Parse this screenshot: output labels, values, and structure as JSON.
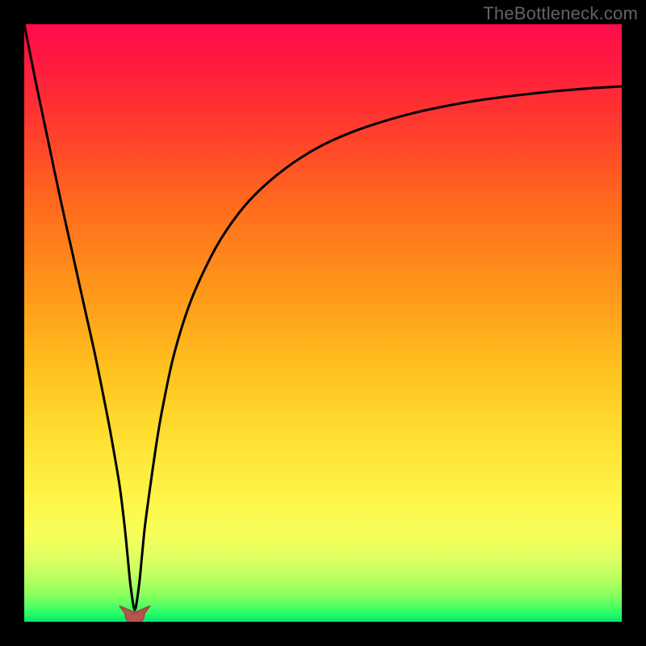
{
  "watermark": "TheBottleneck.com",
  "colors": {
    "frame": "#000000",
    "curve": "#000000",
    "marker_fill": "#b6554c",
    "marker_stroke": "#a04a42",
    "gradient_stops": [
      {
        "offset": 0.0,
        "color": "#ff0a4a"
      },
      {
        "offset": 0.08,
        "color": "#ff1f3d"
      },
      {
        "offset": 0.18,
        "color": "#ff3e2c"
      },
      {
        "offset": 0.3,
        "color": "#ff6a1e"
      },
      {
        "offset": 0.45,
        "color": "#ff981a"
      },
      {
        "offset": 0.58,
        "color": "#ffc21e"
      },
      {
        "offset": 0.7,
        "color": "#ffe233"
      },
      {
        "offset": 0.8,
        "color": "#fff64a"
      },
      {
        "offset": 0.86,
        "color": "#f4ff5c"
      },
      {
        "offset": 0.9,
        "color": "#d9ff62"
      },
      {
        "offset": 0.93,
        "color": "#b6ff60"
      },
      {
        "offset": 0.96,
        "color": "#7eff5d"
      },
      {
        "offset": 0.985,
        "color": "#2bff68"
      },
      {
        "offset": 1.0,
        "color": "#00e56f"
      }
    ]
  },
  "chart_data": {
    "type": "line",
    "title": "",
    "xlabel": "",
    "ylabel": "",
    "xlim": [
      0,
      100
    ],
    "ylim": [
      0,
      100
    ],
    "notch": {
      "x": 18.5,
      "width": 3.0,
      "depth": 98
    },
    "series": [
      {
        "name": "bottleneck-curve",
        "x": [
          0,
          2,
          4,
          6,
          8,
          10,
          12,
          14,
          15,
          16,
          16.8,
          17.3,
          17.8,
          18.5,
          19.2,
          19.7,
          20.2,
          21,
          22,
          23,
          25,
          28,
          32,
          36,
          40,
          45,
          50,
          55,
          60,
          65,
          70,
          75,
          80,
          85,
          90,
          95,
          100
        ],
        "y": [
          100,
          90,
          80.5,
          71,
          62,
          53,
          44,
          34,
          28.5,
          22.5,
          16,
          11,
          6,
          2,
          6,
          11,
          16,
          22,
          29,
          35,
          44.5,
          54,
          62.5,
          68.5,
          72.8,
          76.8,
          79.8,
          82.0,
          83.7,
          85.1,
          86.2,
          87.1,
          87.8,
          88.4,
          88.9,
          89.3,
          89.6
        ]
      }
    ],
    "marker_points": [
      {
        "x": 17.1,
        "y": 2.6
      },
      {
        "x": 18.0,
        "y": 1.4
      },
      {
        "x": 19.0,
        "y": 1.4
      },
      {
        "x": 19.9,
        "y": 2.6
      }
    ],
    "annotations": []
  }
}
